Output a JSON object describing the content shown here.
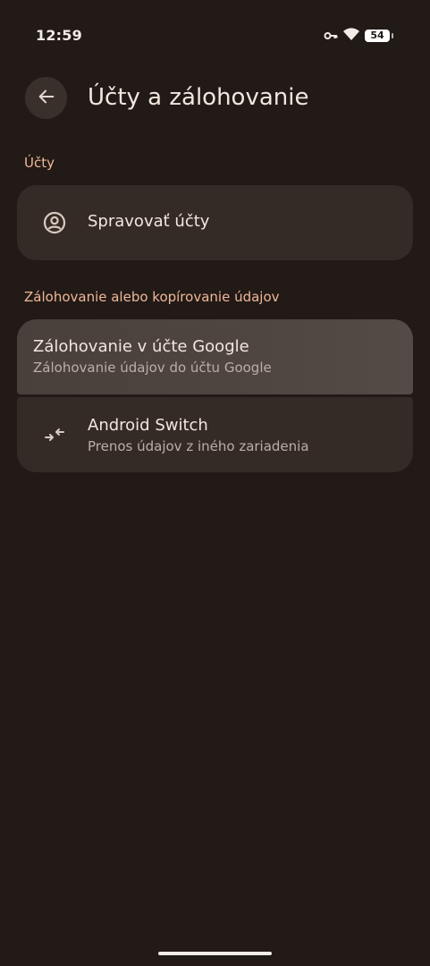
{
  "status_bar": {
    "time": "12:59",
    "battery": "54",
    "icons": [
      "vpn-key-icon",
      "wifi-icon",
      "battery-icon"
    ]
  },
  "header": {
    "back_icon": "arrow-back-icon",
    "title": "Účty a zálohovanie"
  },
  "sections": [
    {
      "label": "Účty",
      "items": [
        {
          "icon": "account-circle-icon",
          "title": "Spravovať účty"
        }
      ]
    },
    {
      "label": "Zálohovanie alebo kopírovanie údajov",
      "items": [
        {
          "title": "Zálohovanie v účte Google",
          "subtitle": "Zálohovanie údajov do účtu Google"
        },
        {
          "icon": "switch-arrows-icon",
          "title": "Android Switch",
          "subtitle": "Prenos údajov z iného zariadenia"
        }
      ]
    }
  ],
  "colors": {
    "background": "#211a16",
    "card": "#352b26",
    "card_highlight": "#4e4540",
    "accent": "#f0b79a",
    "text_primary": "#f2e6de",
    "text_secondary": "#bcaea6"
  }
}
